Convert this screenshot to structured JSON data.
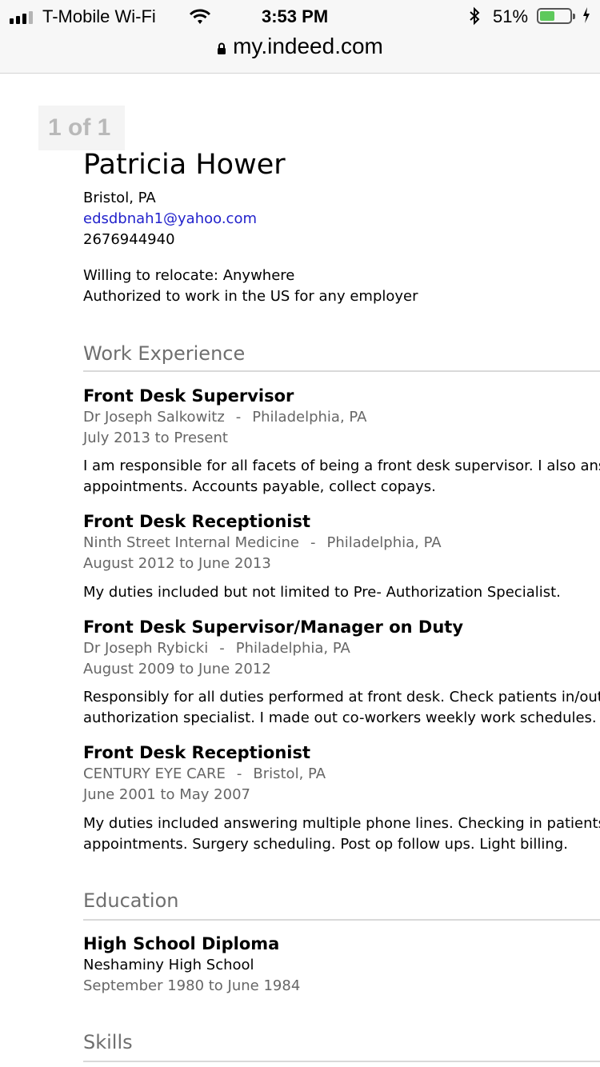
{
  "status": {
    "carrier": "T-Mobile Wi-Fi",
    "time": "3:53 PM",
    "battery_pct": "51%",
    "battery_level": 0.51
  },
  "browser": {
    "url": "my.indeed.com"
  },
  "pager": {
    "label": "1 of 1"
  },
  "resume": {
    "name": "Patricia Hower",
    "location": "Bristol, PA",
    "email": "edsdbnah1@yahoo.com",
    "phone": "2676944940",
    "relocate": "Willing to relocate: Anywhere",
    "authorization": "Authorized to work in the US for any employer",
    "work_title": "Work Experience",
    "jobs": [
      {
        "title": "Front Desk Supervisor",
        "company": "Dr Joseph Salkowitz",
        "location": "Philadelphia, PA",
        "dates": "July 2013 to Present",
        "desc": [
          "I am responsible for all facets of being a front desk supervisor. I also ans",
          "appointments. Accounts payable, collect copays."
        ]
      },
      {
        "title": "Front Desk Receptionist",
        "company": "Ninth Street Internal Medicine",
        "location": "Philadelphia, PA",
        "dates": "August 2012 to June 2013",
        "desc": [
          "My duties included but not limited to Pre- Authorization Specialist."
        ]
      },
      {
        "title": "Front Desk Supervisor/Manager on Duty",
        "company": "Dr Joseph Rybicki",
        "location": "Philadelphia, PA",
        "dates": "August 2009 to June 2012",
        "desc": [
          "Responsibly for all duties performed at front desk. Check patients in/out",
          "authorization specialist. I made out co-workers weekly work schedules."
        ]
      },
      {
        "title": "Front Desk Receptionist",
        "company": "CENTURY EYE CARE",
        "location": "Bristol, PA",
        "dates": "June 2001 to May 2007",
        "desc": [
          "My duties included answering multiple phone lines. Checking in patients",
          "appointments. Surgery scheduling. Post op follow ups. Light billing."
        ]
      }
    ],
    "education_title": "Education",
    "education": {
      "degree": "High School Diploma",
      "school": "Neshaminy High School",
      "dates": "September 1980 to June 1984"
    },
    "skills_title": "Skills",
    "separator": "-"
  }
}
